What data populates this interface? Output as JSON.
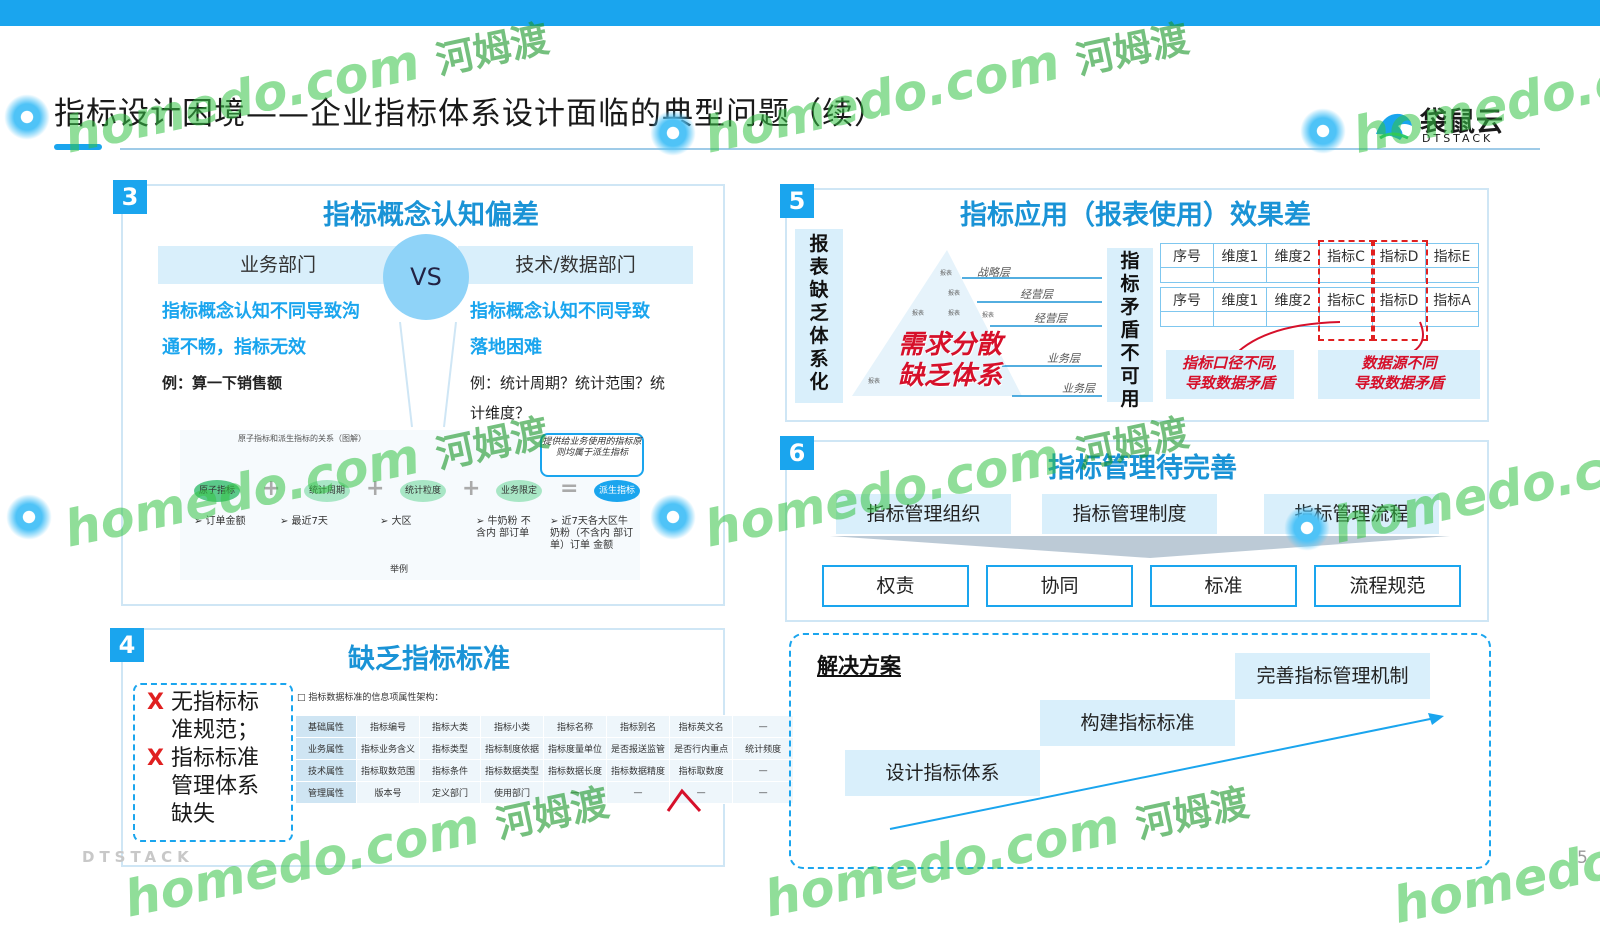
{
  "title": "指标设计困境——企业指标体系设计面临的典型问题（续）",
  "logo": {
    "name": "袋鼠云",
    "sub": "DTSTACK"
  },
  "section3": {
    "number": "3",
    "title": "指标概念认知偏差",
    "vs": "VS",
    "left_head": "业务部门",
    "right_head": "技术/数据部门",
    "left_blue_1": "指标概念认知不同导致沟",
    "left_blue_2": "通不畅，指标无效",
    "left_example": "例：算一下销售额",
    "right_blue_1": "指标概念认知不同导致",
    "right_blue_2": "落地困难",
    "right_example_1": "例：统计周期？统计范围？统",
    "right_example_2": "计维度？",
    "callout": "提供给业务使用的指标原则均属于派生指标",
    "formula_nodes": [
      "原子指标",
      "统计周期",
      "统计粒度",
      "业务限定",
      "派生指标"
    ],
    "formula_ops": [
      "+",
      "+",
      "+",
      "="
    ],
    "formula_subs": [
      "➢ 订单金额",
      "➢ 最近7天",
      "➢ 大区",
      "➢ 牛奶粉 不含内 部订单",
      "➢ 近7天各大区牛 奶粉（不含内 部订单）订单 金额"
    ],
    "formula_caption": "原子指标和派生指标的关系（图解）",
    "formula_footer": "举例"
  },
  "section4": {
    "number": "4",
    "title": "缺乏指标标准",
    "x_items": [
      {
        "mark": "X",
        "lines": [
          "无指标标",
          "准规范；"
        ]
      },
      {
        "mark": "X",
        "lines": [
          "指标标准",
          "管理体系",
          "缺失"
        ]
      }
    ],
    "table_caption": "□ 指标数据标准的信息项属性架构：",
    "table_rows": [
      [
        "基础属性",
        "指标编号",
        "指标大类",
        "指标小类",
        "指标名称",
        "指标别名",
        "指标英文名",
        "—"
      ],
      [
        "业务属性",
        "指标业务含义",
        "指标类型",
        "指标制度依据",
        "指标度量单位",
        "是否报送监管",
        "是否行内重点",
        "统计频度"
      ],
      [
        "技术属性",
        "指标取数范围",
        "指标条件",
        "指标数据类型",
        "指标数据长度",
        "指标数据精度",
        "指标取数度",
        "—"
      ],
      [
        "管理属性",
        "版本号",
        "定义部门",
        "使用部门",
        "—",
        "—",
        "—",
        "—"
      ]
    ]
  },
  "section5": {
    "number": "5",
    "title": "指标应用（报表使用）效果差",
    "left_vertical": "报表缺乏体系化",
    "pyramid_levels": [
      "战略层",
      "经营层",
      "经营层",
      "业务层",
      "业务层"
    ],
    "pyramid_tags": [
      "报表",
      "报表",
      "报表",
      "报表",
      "报表",
      "报表"
    ],
    "red_text_1": "需求分散",
    "red_text_2": "缺乏体系",
    "mid_vertical": "指标矛盾不可用",
    "table1": [
      "序号",
      "维度1",
      "维度2",
      "指标C",
      "指标D",
      "指标E"
    ],
    "table2": [
      "序号",
      "维度1",
      "维度2",
      "指标C",
      "指标D",
      "指标A"
    ],
    "reason1": [
      "指标口径不同,",
      "导致数据矛盾"
    ],
    "reason2": [
      "数据源不同",
      "导致数据矛盾"
    ]
  },
  "section6": {
    "number": "6",
    "title": "指标管理待完善",
    "heads": [
      "指标管理组织",
      "指标管理制度",
      "指标管理流程"
    ],
    "buttons": [
      "权责",
      "协同",
      "标准",
      "流程规范"
    ]
  },
  "solution": {
    "title": "解决方案",
    "steps": [
      "设计指标体系",
      "构建指标标准",
      "完善指标管理机制"
    ]
  },
  "footer": "DTSTACK",
  "page_number": "5",
  "watermark": {
    "text": "homedo.com",
    "cn": "河姆渡"
  },
  "colors": {
    "accent": "#1aa5ee",
    "title_blue": "#1a93d6",
    "red": "#d6102a",
    "light_fill": "#d9effb"
  }
}
